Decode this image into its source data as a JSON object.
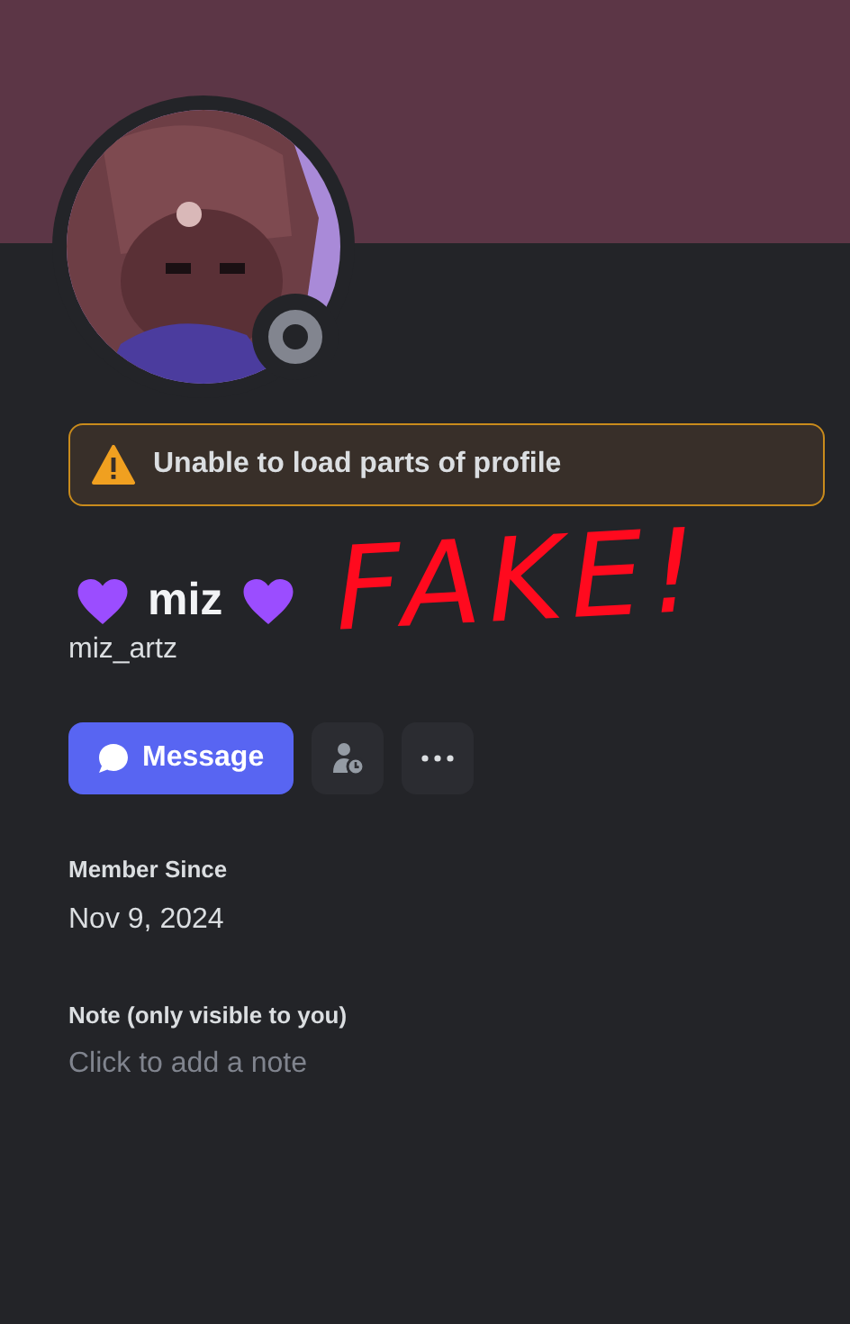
{
  "warning": {
    "text": "Unable to load parts of profile"
  },
  "profile": {
    "display_name": "miz",
    "username": "miz_artz"
  },
  "annotation": {
    "text": "FAKE!"
  },
  "actions": {
    "message_label": "Message"
  },
  "member_since": {
    "label": "Member Since",
    "value": "Nov 9, 2024"
  },
  "note": {
    "label": "Note (only visible to you)",
    "placeholder": "Click to add a note"
  }
}
